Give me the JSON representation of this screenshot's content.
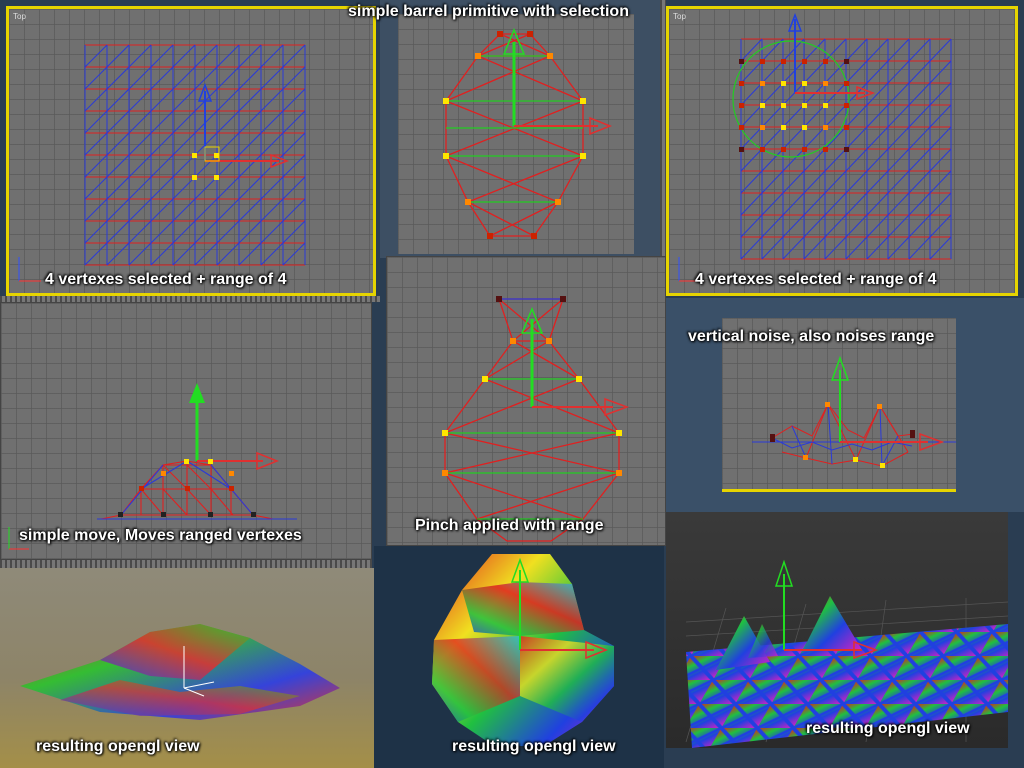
{
  "captions": {
    "barrel_title": "simple barrel primitive with selection",
    "top_left": "4 vertexes selected + range of 4",
    "top_right": "4 vertexes selected + range of 4",
    "middle_left": "simple move, Moves ranged vertexes",
    "middle_center": "Pinch applied with range",
    "middle_right": "vertical noise, also noises range",
    "bottom_left": "resulting opengl view",
    "bottom_center": "resulting opengl view",
    "bottom_right": "resulting opengl view"
  },
  "viewports": {
    "top_left_label": "Top",
    "top_right_label": "Top"
  },
  "colors": {
    "wire_red": "#e02020",
    "wire_blue": "#2a3ad8",
    "selection_yellow": "#ffe600",
    "gizmo_green": "#22cc22",
    "gizmo_blue": "#2040e0",
    "gizmo_red": "#e03030"
  },
  "icons": [
    "axis-tripod-icon",
    "move-gizmo-icon",
    "soft-selection-circle-icon"
  ]
}
